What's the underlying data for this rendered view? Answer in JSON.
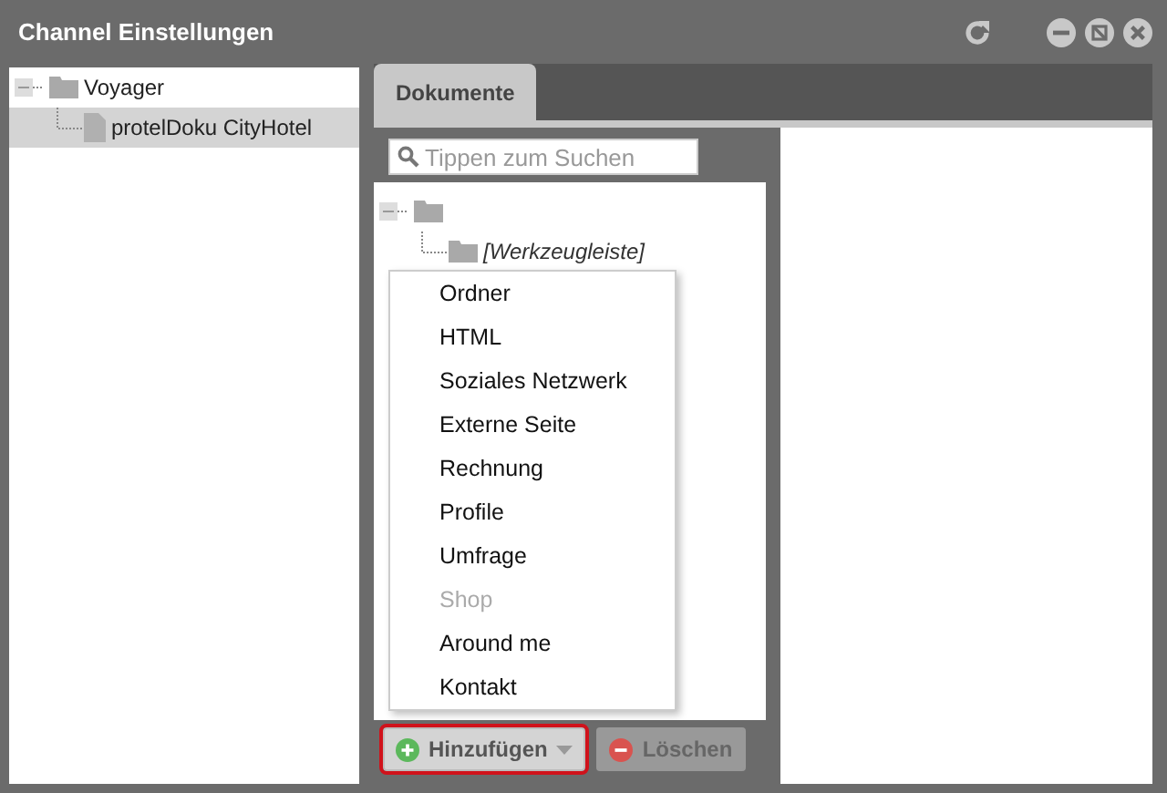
{
  "window": {
    "title": "Channel Einstellungen"
  },
  "channels_tree": [
    {
      "label": "Voyager",
      "kind": "folder",
      "expanded": true,
      "selected": false,
      "children": [
        {
          "label": "protelDoku CityHotel",
          "kind": "file",
          "selected": true
        }
      ]
    }
  ],
  "tabs": [
    {
      "label": "Dokumente",
      "selected": true
    }
  ],
  "search": {
    "placeholder": "Tippen zum Suchen"
  },
  "document_tree": {
    "expanded": true,
    "children": [
      {
        "label": "[Werkzeugleiste]",
        "kind": "folder"
      }
    ]
  },
  "add_menu": [
    {
      "label": "Ordner",
      "disabled": false
    },
    {
      "label": "HTML",
      "disabled": false
    },
    {
      "label": "Soziales Netzwerk",
      "disabled": false
    },
    {
      "label": "Externe Seite",
      "disabled": false
    },
    {
      "label": "Rechnung",
      "disabled": false
    },
    {
      "label": "Profile",
      "disabled": false
    },
    {
      "label": "Umfrage",
      "disabled": false
    },
    {
      "label": "Shop",
      "disabled": true
    },
    {
      "label": "Around me",
      "disabled": false
    },
    {
      "label": "Kontakt",
      "disabled": false
    }
  ],
  "buttons": [
    {
      "label": "Hinzufügen",
      "kind": "add",
      "disabled": false,
      "highlighted": true
    },
    {
      "label": "Löschen",
      "kind": "delete",
      "disabled": true,
      "highlighted": false
    }
  ]
}
